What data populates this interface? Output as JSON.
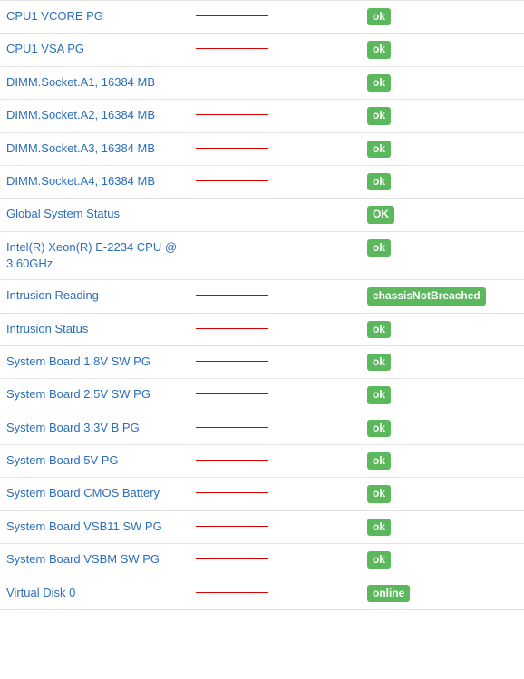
{
  "rows": [
    {
      "name": "CPU1 VCORE PG",
      "graph": true,
      "status": "ok"
    },
    {
      "name": "CPU1 VSA PG",
      "graph": true,
      "status": "ok"
    },
    {
      "name": "DIMM.Socket.A1, 16384 MB",
      "graph": true,
      "status": "ok"
    },
    {
      "name": "DIMM.Socket.A2, 16384 MB",
      "graph": true,
      "status": "ok"
    },
    {
      "name": "DIMM.Socket.A3, 16384 MB",
      "graph": true,
      "status": "ok"
    },
    {
      "name": "DIMM.Socket.A4, 16384 MB",
      "graph": true,
      "status": "ok"
    },
    {
      "name": "Global System Status",
      "graph": false,
      "status": "OK"
    },
    {
      "name": "Intel(R) Xeon(R) E-2234 CPU @ 3.60GHz",
      "graph": true,
      "status": "ok"
    },
    {
      "name": "Intrusion Reading",
      "graph": true,
      "status": "chassisNotBreached"
    },
    {
      "name": "Intrusion Status",
      "graph": true,
      "status": "ok"
    },
    {
      "name": "System Board 1.8V SW PG",
      "graph": true,
      "status": "ok"
    },
    {
      "name": "System Board 2.5V SW PG",
      "graph": true,
      "status": "ok"
    },
    {
      "name": "System Board 3.3V B PG",
      "graph": true,
      "status": "ok"
    },
    {
      "name": "System Board 5V PG",
      "graph": true,
      "status": "ok"
    },
    {
      "name": "System Board CMOS Battery",
      "graph": true,
      "status": "ok"
    },
    {
      "name": "System Board VSB11 SW PG",
      "graph": true,
      "status": "ok"
    },
    {
      "name": "System Board VSBM SW PG",
      "graph": true,
      "status": "ok"
    },
    {
      "name": "Virtual Disk 0",
      "graph": true,
      "status": "online"
    }
  ]
}
